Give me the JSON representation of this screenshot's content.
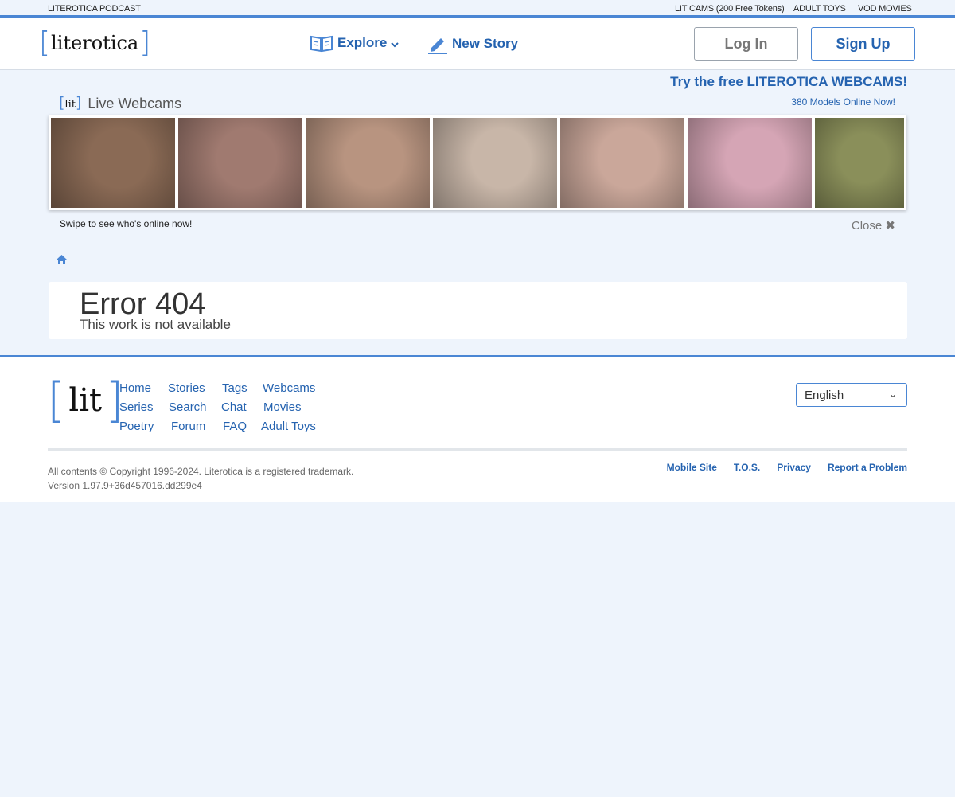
{
  "topstrip": {
    "podcast": "LITEROTICA PODCAST",
    "lit_cams": "LIT CAMS (200 Free Tokens)",
    "adult_toys": "ADULT TOYS",
    "vod_movies": "VOD MOVIES"
  },
  "header": {
    "logo_text": "literotica",
    "explore": "Explore",
    "new_story": "New Story",
    "login": "Log In",
    "signup": "Sign Up",
    "accent": "#4a86d4",
    "link_color": "#2563b0"
  },
  "webcams": {
    "mini_logo": "lit",
    "title": "Live Webcams",
    "try_text": "Try the free LITEROTICA WEBCAMS!",
    "online_text": "380 Models Online Now!",
    "swipe_text": "Swipe to see who's online now!",
    "close_text": "Close",
    "thumb_colors": [
      "#8a6a55",
      "#a07a70",
      "#b89480",
      "#c8b6a8",
      "#caa79a",
      "#d5a5b5",
      "#8a8f5a"
    ]
  },
  "error": {
    "title": "Error 404",
    "subtitle": "This work is not available"
  },
  "footer": {
    "logo_text": "lit",
    "links": {
      "col1": [
        "Home",
        "Series",
        "Poetry"
      ],
      "col2": [
        "Stories",
        "Search",
        "Forum"
      ],
      "col3": [
        "Tags",
        "Chat",
        "FAQ"
      ],
      "col4": [
        "Webcams",
        "Movies",
        "Adult Toys"
      ]
    },
    "language": "English",
    "copyright": "All contents © Copyright 1996-2024. Literotica is a registered trademark.",
    "version": "Version 1.97.9+36d457016.dd299e4",
    "bottom_links": [
      "Mobile Site",
      "T.O.S.",
      "Privacy",
      "Report a Problem"
    ]
  }
}
